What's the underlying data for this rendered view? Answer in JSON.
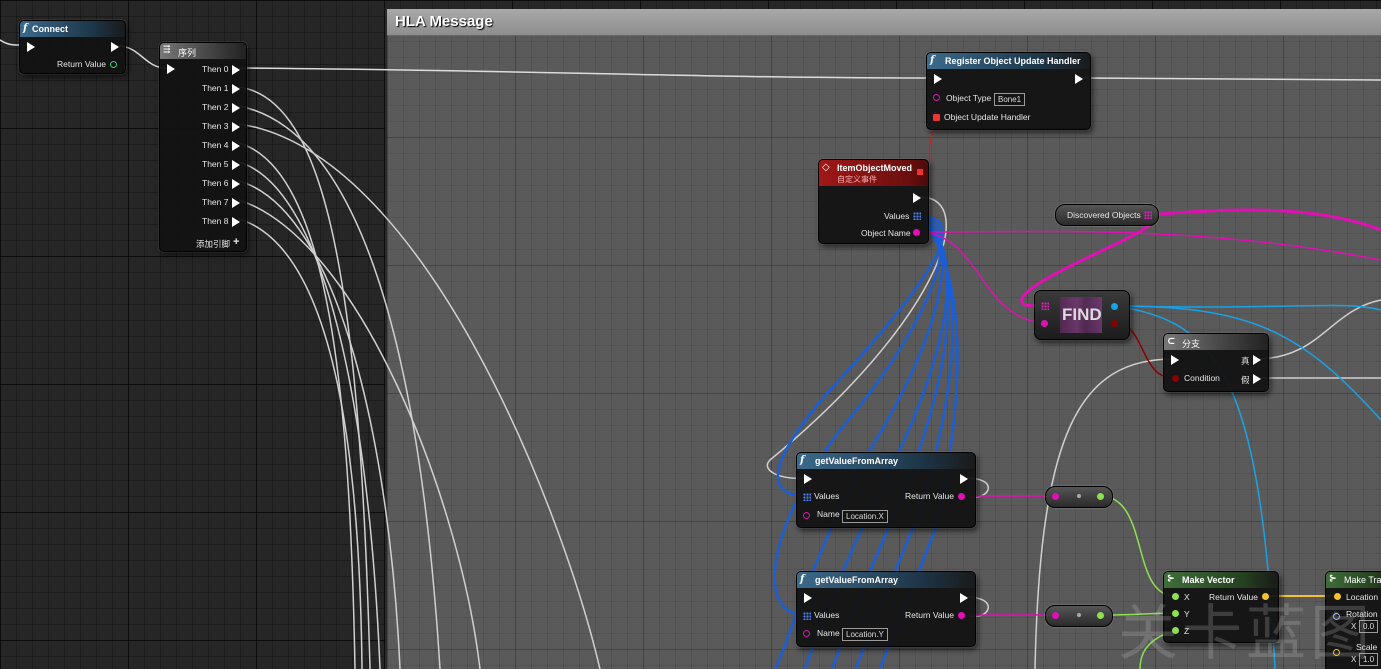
{
  "comment": {
    "title": "HLA Message"
  },
  "nodes": {
    "connect": {
      "title": "Connect",
      "return_label": "Return Value"
    },
    "sequence": {
      "title": "序列",
      "outputs": [
        "Then 0",
        "Then 1",
        "Then 2",
        "Then 3",
        "Then 4",
        "Then 5",
        "Then 6",
        "Then 7",
        "Then 8"
      ],
      "add_pin": "添加引脚"
    },
    "register": {
      "title": "Register Object Update Handler",
      "object_type_label": "Object Type",
      "object_type_value": "Bone1",
      "handler_label": "Object Update Handler"
    },
    "event": {
      "title": "ItemObjectMoved",
      "subtitle": "自定义事件",
      "values_label": "Values",
      "object_name_label": "Object Name"
    },
    "discovered": {
      "label": "Discovered Objects"
    },
    "find": {
      "label": "FIND"
    },
    "branch": {
      "title": "分支",
      "condition_label": "Condition",
      "true_label": "真",
      "false_label": "假"
    },
    "get_x": {
      "title": "getValueFromArray",
      "values_label": "Values",
      "name_label": "Name",
      "name_value": "Location.X",
      "return_label": "Return Value"
    },
    "get_y": {
      "title": "getValueFromArray",
      "values_label": "Values",
      "name_label": "Name",
      "name_value": "Location.Y",
      "return_label": "Return Value"
    },
    "make_vector": {
      "title": "Make Vector",
      "x_label": "X",
      "y_label": "Y",
      "z_label": "Z",
      "return_label": "Return Value"
    },
    "make_transform": {
      "title": "Make Tra",
      "location_label": "Location",
      "rotation_label": "Rotation",
      "rotation_value": "0.0",
      "rotation_axis": "X",
      "scale_label": "Scale",
      "scale_value": "1.0",
      "scale_axis": "X"
    }
  },
  "watermark": "关卡蓝图",
  "colors": {
    "exec": "#ffffff",
    "array": "#1e62e0",
    "string": "#e010b4",
    "float": "#8ee050",
    "vector": "#f5c22b",
    "bool": "#8b0000",
    "object": "#19a2e6"
  }
}
